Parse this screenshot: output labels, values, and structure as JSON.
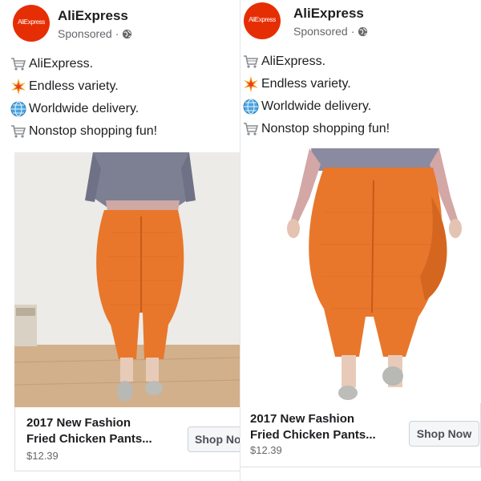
{
  "posts": [
    {
      "logo_text": "AliExpress",
      "page_name": "AliExpress",
      "meta": "Sponsored",
      "meta_dot": "·",
      "lines": [
        {
          "icon": "shopping-cart-icon",
          "text": "AliExpress."
        },
        {
          "icon": "sparkle-icon",
          "text": "Endless variety."
        },
        {
          "icon": "globe-icon",
          "text": "Worldwide delivery."
        },
        {
          "icon": "shopping-cart-icon",
          "text": "Nonstop shopping fun!"
        }
      ],
      "card": {
        "title_line1": "2017 New Fashion",
        "title_line2": "Fried Chicken Pants...",
        "price": "$12.39",
        "button": "Shop Now"
      }
    },
    {
      "logo_text": "AliExpress",
      "page_name": "AliExpress",
      "meta": "Sponsored",
      "meta_dot": "·",
      "lines": [
        {
          "icon": "shopping-cart-icon",
          "text": "AliExpress."
        },
        {
          "icon": "sparkle-icon",
          "text": "Endless variety."
        },
        {
          "icon": "globe-icon",
          "text": "Worldwide delivery."
        },
        {
          "icon": "shopping-cart-icon",
          "text": "Nonstop shopping fun!"
        }
      ],
      "card": {
        "title_line1": "2017 New Fashion",
        "title_line2": "Fried Chicken Pants...",
        "price": "$12.39",
        "button": "Shop Now"
      }
    }
  ],
  "colors": {
    "brand": "#e62e04",
    "pants": "#e8772c",
    "text": "#1c1e21",
    "muted": "#65676b"
  }
}
